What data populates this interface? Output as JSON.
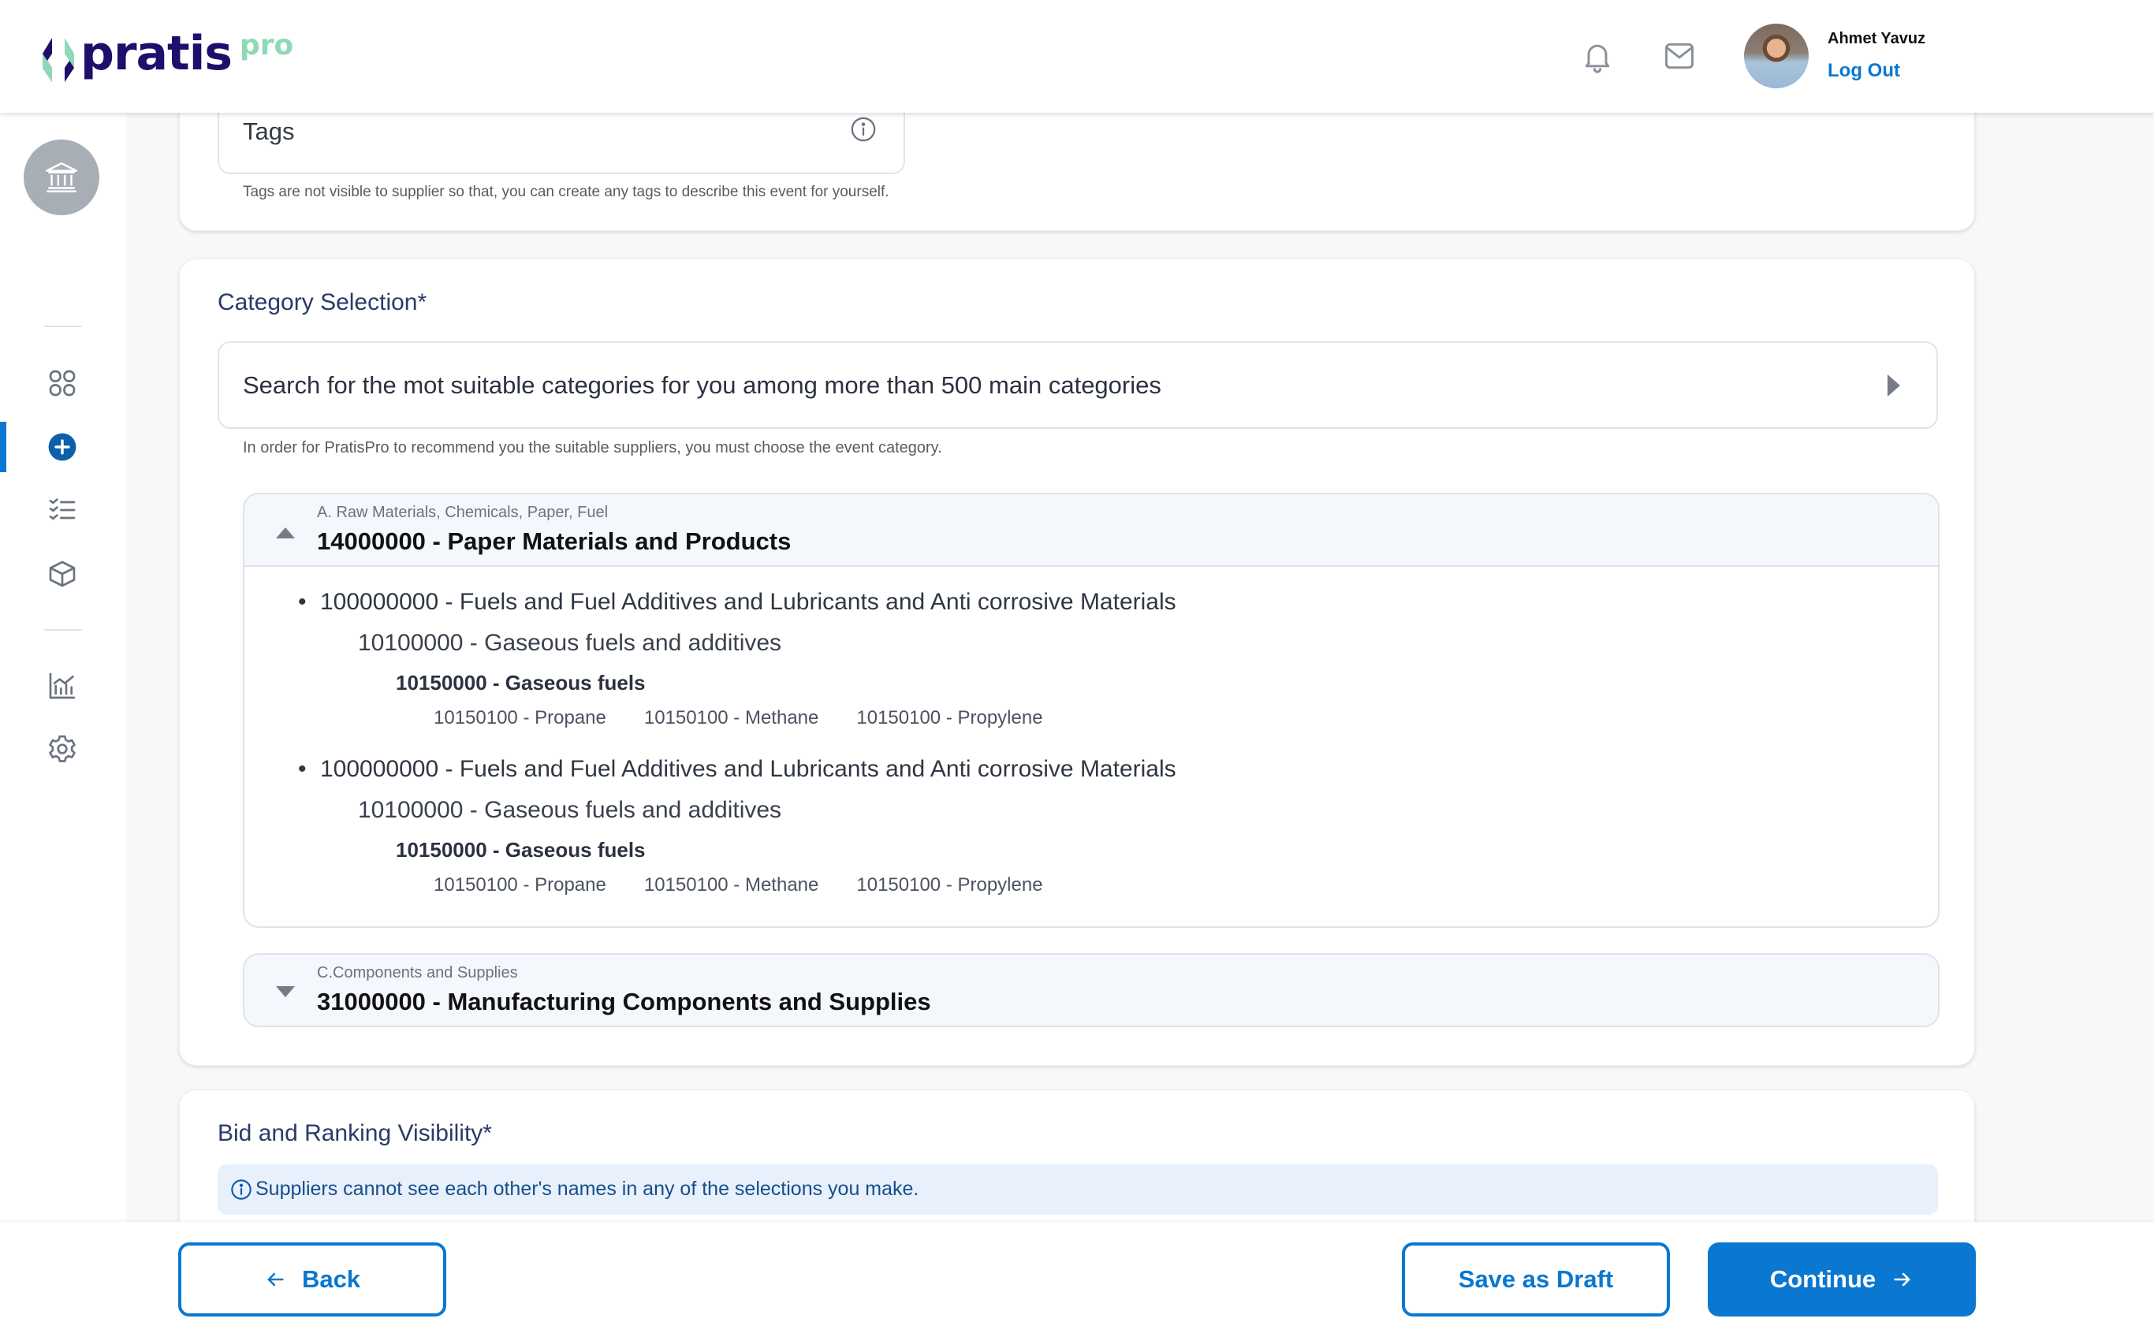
{
  "header": {
    "logo_text": "pratis",
    "logo_suffix": "pro",
    "user_name": "Ahmet Yavuz",
    "logout_label": "Log Out",
    "icons": [
      "bell-icon",
      "mail-icon"
    ]
  },
  "sidebar": {
    "org_icon": "bank-icon",
    "items": [
      {
        "icon": "dashboard-grid-icon",
        "active": false
      },
      {
        "icon": "plus-circle-icon",
        "active": true
      },
      {
        "icon": "checklist-icon",
        "active": false
      },
      {
        "icon": "box-icon",
        "active": false
      },
      {
        "icon": "chart-icon",
        "active": false
      },
      {
        "icon": "gear-icon",
        "active": false
      }
    ]
  },
  "tags": {
    "label": "Tags",
    "hint": "Tags are not visible to supplier so that, you can create any tags to describe this event for yourself."
  },
  "category": {
    "title": "Category Selection*",
    "search_placeholder": "Search for the mot suitable categories for you among more than 500 main categories",
    "hint": "In order for PratisPro to recommend you the suitable suppliers, you must choose the event category.",
    "groups": [
      {
        "group": "A. Raw Materials, Chemicals, Paper, Fuel",
        "title": "14000000 - Paper Materials and Products",
        "expanded": true,
        "tree": [
          {
            "l1": "100000000 - Fuels and Fuel Additives and Lubricants and Anti corrosive Materials",
            "l2": "10100000 - Gaseous fuels and additives",
            "l3": "10150000 - Gaseous fuels",
            "l4": [
              "10150100 - Propane",
              "10150100 - Methane",
              "10150100 - Propylene"
            ]
          },
          {
            "l1": "100000000 - Fuels and Fuel Additives and Lubricants and Anti corrosive Materials",
            "l2": "10100000 - Gaseous fuels and additives",
            "l3": "10150000 - Gaseous fuels",
            "l4": [
              "10150100 - Propane",
              "10150100 - Methane",
              "10150100 - Propylene"
            ]
          }
        ]
      },
      {
        "group": "C.Components and Supplies",
        "title": "31000000 - Manufacturing Components and Supplies",
        "expanded": false
      }
    ]
  },
  "bid": {
    "title": "Bid and Ranking Visibility*",
    "info": "Suppliers cannot see each other's names in any of the selections you make."
  },
  "footer": {
    "back_label": "Back",
    "draft_label": "Save as Draft",
    "continue_label": "Continue"
  },
  "colors": {
    "primary": "#0a78d0",
    "brand_dark": "#1f0e6b",
    "brand_mint": "#8fd9b6",
    "info_bg": "#e8f0fc"
  }
}
